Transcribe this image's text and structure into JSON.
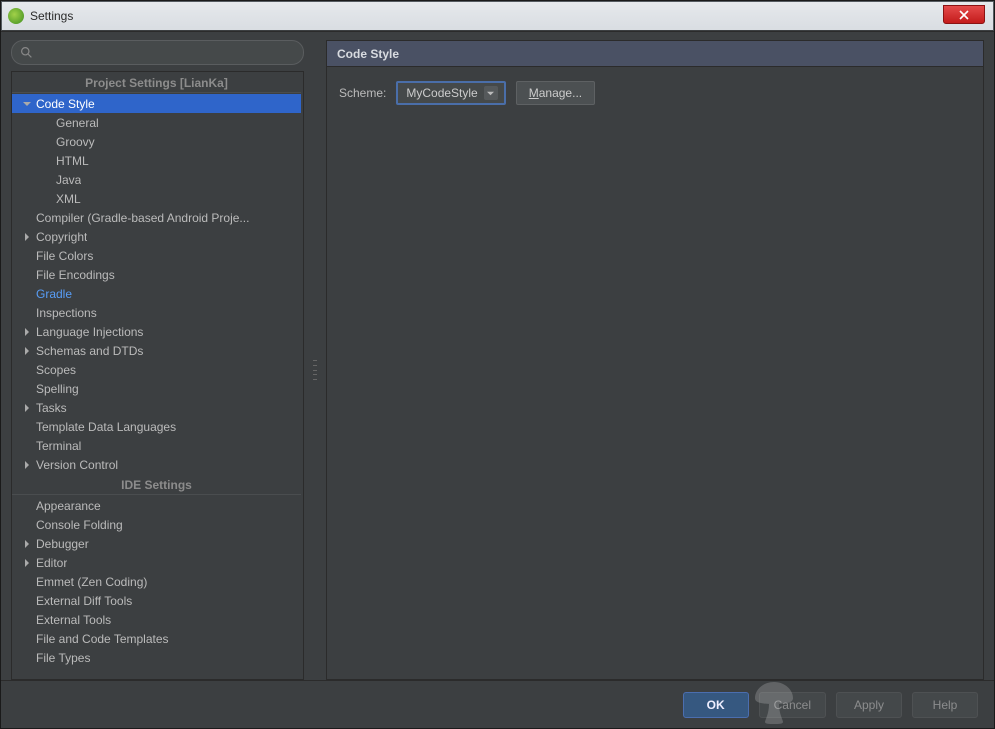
{
  "window": {
    "title": "Settings"
  },
  "search": {
    "placeholder": ""
  },
  "panel": {
    "title": "Code Style",
    "scheme_label": "Scheme:",
    "scheme_value": "MyCodeStyle",
    "manage_label_u": "M",
    "manage_label_rest": "anage..."
  },
  "buttons": {
    "ok": "OK",
    "cancel": "Cancel",
    "apply": "Apply",
    "help": "Help"
  },
  "sections": {
    "project": "Project Settings [LianKa]",
    "ide": "IDE Settings"
  },
  "tree": {
    "project": [
      {
        "label": "Code Style",
        "arrow": "down",
        "selected": true
      },
      {
        "label": "General",
        "child": true
      },
      {
        "label": "Groovy",
        "child": true
      },
      {
        "label": "HTML",
        "child": true
      },
      {
        "label": "Java",
        "child": true
      },
      {
        "label": "XML",
        "child": true
      },
      {
        "label": "Compiler (Gradle-based Android Proje..."
      },
      {
        "label": "Copyright",
        "arrow": "right"
      },
      {
        "label": "File Colors"
      },
      {
        "label": "File Encodings"
      },
      {
        "label": "Gradle",
        "link": true
      },
      {
        "label": "Inspections"
      },
      {
        "label": "Language Injections",
        "arrow": "right"
      },
      {
        "label": "Schemas and DTDs",
        "arrow": "right"
      },
      {
        "label": "Scopes"
      },
      {
        "label": "Spelling"
      },
      {
        "label": "Tasks",
        "arrow": "right"
      },
      {
        "label": "Template Data Languages"
      },
      {
        "label": "Terminal"
      },
      {
        "label": "Version Control",
        "arrow": "right"
      }
    ],
    "ide": [
      {
        "label": "Appearance"
      },
      {
        "label": "Console Folding"
      },
      {
        "label": "Debugger",
        "arrow": "right"
      },
      {
        "label": "Editor",
        "arrow": "right"
      },
      {
        "label": "Emmet (Zen Coding)"
      },
      {
        "label": "External Diff Tools"
      },
      {
        "label": "External Tools"
      },
      {
        "label": "File and Code Templates"
      },
      {
        "label": "File Types"
      }
    ]
  }
}
